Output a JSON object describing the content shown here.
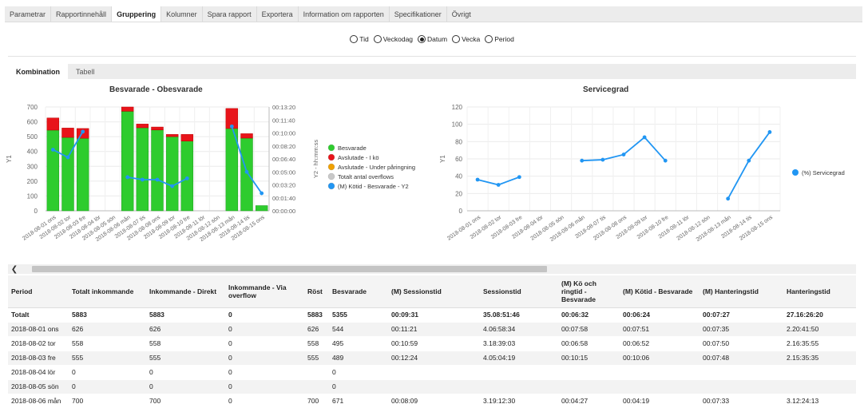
{
  "top_tabs": [
    "Parametrar",
    "Rapportinnehåll",
    "Gruppering",
    "Kolumner",
    "Spara rapport",
    "Exportera",
    "Information om rapporten",
    "Specifikationer",
    "Övrigt"
  ],
  "top_tab_active": "Gruppering",
  "radio_options": [
    {
      "label": "Tid",
      "selected": false
    },
    {
      "label": "Veckodag",
      "selected": false
    },
    {
      "label": "Datum",
      "selected": true
    },
    {
      "label": "Vecka",
      "selected": false
    },
    {
      "label": "Period",
      "selected": false
    }
  ],
  "sub_tabs": [
    "Kombination",
    "Tabell"
  ],
  "sub_tab_active": "Kombination",
  "colors": {
    "green": "#2ecc2e",
    "red": "#e8141a",
    "orange": "#f0a000",
    "gray": "#c8c8c8",
    "blue": "#2196f3"
  },
  "chart_data": [
    {
      "type": "bar",
      "title": "Besvarade - Obesvarade",
      "ylabel": "Y1",
      "y2label": "Y2 - hh:mm:ss",
      "ylim": [
        0,
        700
      ],
      "yticks": [
        "0",
        "100",
        "200",
        "300",
        "400",
        "500",
        "600",
        "700"
      ],
      "y2ticks": [
        "00:00:00",
        "00:01:40",
        "00:03:20",
        "00:05:00",
        "00:06:40",
        "00:08:20",
        "00:10:00",
        "00:11:40",
        "00:13:20"
      ],
      "categories": [
        "2018-08-01 ons",
        "2018-08-02 tor",
        "2018-08-03 fre",
        "2018-08-04 lör",
        "2018-08-05 sön",
        "2018-08-06 mån",
        "2018-08-07 tis",
        "2018-08-08 ons",
        "2018-08-09 tor",
        "2018-08-10 fre",
        "2018-08-11 lör",
        "2018-08-12 sön",
        "2018-08-13 mån",
        "2018-08-14 tis",
        "2018-08-15 ons"
      ],
      "series": [
        {
          "name": "Besvarade",
          "values": [
            544,
            495,
            489,
            0,
            0,
            671,
            560,
            545,
            500,
            470,
            0,
            0,
            555,
            490,
            35
          ]
        },
        {
          "name": "Avslutade - I kö",
          "values": [
            82,
            63,
            66,
            0,
            0,
            29,
            25,
            20,
            15,
            45,
            0,
            0,
            135,
            30,
            0
          ]
        },
        {
          "name": "Avslutade - Under påringning",
          "values": [
            0,
            0,
            0,
            0,
            0,
            0,
            0,
            0,
            0,
            0,
            0,
            0,
            0,
            0,
            0
          ]
        },
        {
          "name": "Totalt antal overflows",
          "values": [
            0,
            0,
            0,
            0,
            0,
            0,
            0,
            0,
            0,
            0,
            0,
            0,
            0,
            0,
            0
          ]
        },
        {
          "name": "(M) Kötid - Besvarade - Y2",
          "values_seconds": [
            471,
            412,
            610,
            null,
            null,
            259,
            240,
            240,
            190,
            250,
            null,
            null,
            650,
            300,
            135
          ]
        }
      ],
      "legend_position": "right"
    },
    {
      "type": "line",
      "title": "Servicegrad",
      "ylabel": "Y1",
      "ylim": [
        0,
        120
      ],
      "yticks": [
        "0",
        "20",
        "40",
        "60",
        "80",
        "100",
        "120"
      ],
      "categories": [
        "2018-08-01 ons",
        "2018-08-02 tor",
        "2018-08-03 fre",
        "2018-08-04 lör",
        "2018-08-05 sön",
        "2018-08-06 mån",
        "2018-08-07 tis",
        "2018-08-08 ons",
        "2018-08-09 tor",
        "2018-08-10 fre",
        "2018-08-11 lör",
        "2018-08-12 sön",
        "2018-08-13 mån",
        "2018-08-14 tis",
        "2018-08-15 ons"
      ],
      "series": [
        {
          "name": "(%) Servicegrad",
          "values": [
            36,
            30,
            39,
            null,
            null,
            58,
            59,
            65,
            85,
            58,
            null,
            null,
            14,
            58,
            91
          ]
        }
      ],
      "legend_position": "right"
    }
  ],
  "table": {
    "headers": [
      "Period",
      "Totalt inkommande",
      "Inkommande - Direkt",
      "Inkommande - Via overflow",
      "Röst",
      "Besvarade",
      "(M) Sessionstid",
      "Sessionstid",
      "(M) Kö och ringtid - Besvarade",
      "(M) Kötid - Besvarade",
      "(M) Hanteringstid",
      "Hanteringstid"
    ],
    "rows": [
      [
        "Totalt",
        "5883",
        "5883",
        "0",
        "5883",
        "5355",
        "00:09:31",
        "35.08:51:46",
        "00:06:32",
        "00:06:24",
        "00:07:27",
        "27.16:26:20"
      ],
      [
        "2018-08-01 ons",
        "626",
        "626",
        "0",
        "626",
        "544",
        "00:11:21",
        "4.06:58:34",
        "00:07:58",
        "00:07:51",
        "00:07:35",
        "2.20:41:50"
      ],
      [
        "2018-08-02 tor",
        "558",
        "558",
        "0",
        "558",
        "495",
        "00:10:59",
        "3.18:39:03",
        "00:06:58",
        "00:06:52",
        "00:07:50",
        "2.16:35:55"
      ],
      [
        "2018-08-03 fre",
        "555",
        "555",
        "0",
        "555",
        "489",
        "00:12:24",
        "4.05:04:19",
        "00:10:15",
        "00:10:06",
        "00:07:48",
        "2.15:35:35"
      ],
      [
        "2018-08-04 lör",
        "0",
        "0",
        "0",
        "",
        "0",
        "",
        "",
        "",
        "",
        "",
        ""
      ],
      [
        "2018-08-05 sön",
        "0",
        "0",
        "0",
        "",
        "0",
        "",
        "",
        "",
        "",
        "",
        ""
      ],
      [
        "2018-08-06 mån",
        "700",
        "700",
        "0",
        "700",
        "671",
        "00:08:09",
        "3.19:12:30",
        "00:04:27",
        "00:04:19",
        "00:07:33",
        "3.12:24:13"
      ]
    ]
  }
}
